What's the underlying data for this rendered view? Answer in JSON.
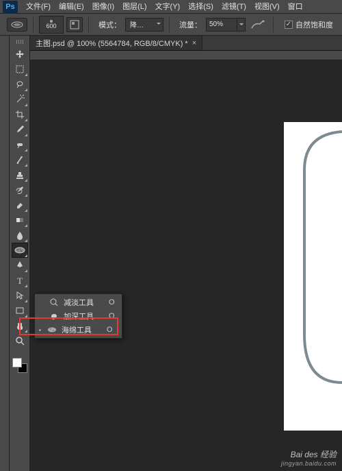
{
  "logo": "Ps",
  "menu": [
    "文件(F)",
    "编辑(E)",
    "图像(I)",
    "图层(L)",
    "文字(Y)",
    "选择(S)",
    "滤镜(T)",
    "视图(V)",
    "窗口"
  ],
  "optbar": {
    "brush_size": "600",
    "mode_label": "模式：",
    "mode_value": "降…",
    "flow_label": "流量：",
    "flow_value": "50%",
    "vibrance_label": "自然饱和度"
  },
  "doc_tab": {
    "title": "主图.psd @ 100% (5564784, RGB/8/CMYK) *",
    "close": "×"
  },
  "flyout": [
    {
      "icon": "dodge",
      "label": "减淡工具",
      "key": "O",
      "selected": false
    },
    {
      "icon": "burn",
      "label": "加深工具",
      "key": "O",
      "selected": false
    },
    {
      "icon": "sponge",
      "label": "海绵工具",
      "key": "O",
      "selected": true
    }
  ],
  "watermark": {
    "line1": "Bai des 经验",
    "line2": "jingyan.baidu.com"
  }
}
